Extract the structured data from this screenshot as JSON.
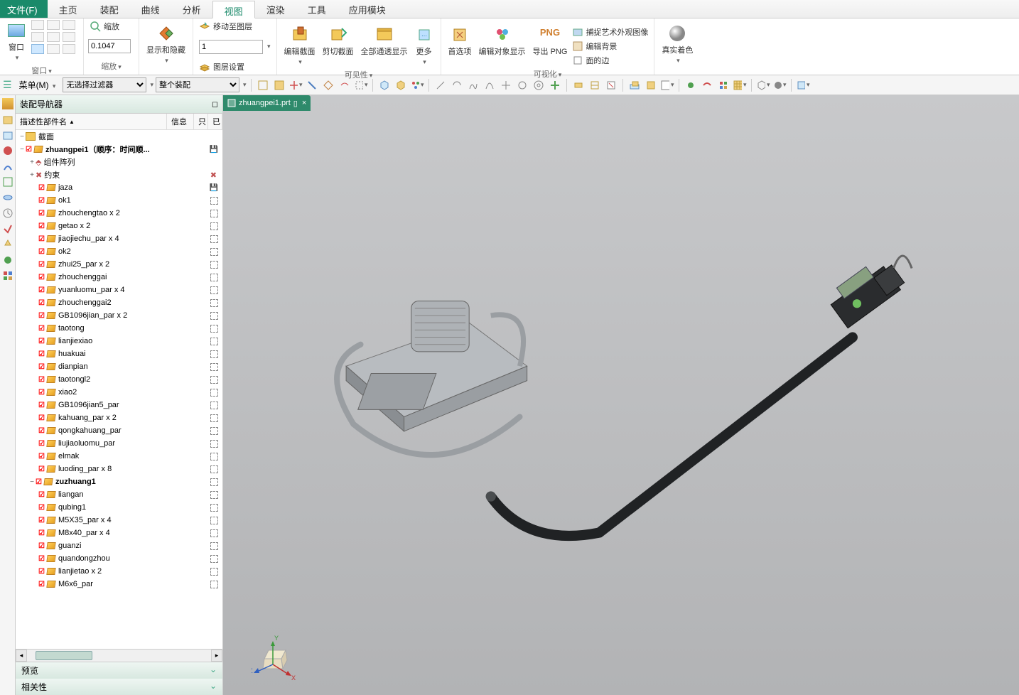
{
  "menu": {
    "file": "文件(F)",
    "tabs": [
      "主页",
      "装配",
      "曲线",
      "分析",
      "视图",
      "渲染",
      "工具",
      "应用模块"
    ],
    "active_index": 4
  },
  "ribbon": {
    "window_group": {
      "label": "窗口",
      "btn": "窗口"
    },
    "zoom_group": {
      "label": "缩放",
      "btn": "缩放",
      "value": "0.1047"
    },
    "show_hide": {
      "label": "显示和隐藏"
    },
    "layer": {
      "move": "移动至图层",
      "settings": "图层设置",
      "combo": "1"
    },
    "visibility_label": "可见性",
    "section": {
      "edit": "编辑截面",
      "cut": "剪切截面",
      "all": "全部通透显示",
      "more": "更多"
    },
    "pref": {
      "label": "首选项"
    },
    "edit_obj": {
      "label": "编辑对象显示"
    },
    "png": {
      "icon": "PNG",
      "label": "导出 PNG"
    },
    "vis_items": {
      "capture": "捕捉艺术外观图像",
      "bg": "编辑背景",
      "face": "面的边"
    },
    "visual_label": "可视化",
    "shade": {
      "label": "真实着色"
    }
  },
  "toolbar": {
    "menu_btn": "菜单(M)",
    "filter1": "无选择过滤器",
    "filter2": "整个装配"
  },
  "panel": {
    "title": "装配导航器",
    "col_name": "描述性部件名",
    "col_info": "信息",
    "col_r": "只",
    "col_c": "已",
    "section_row": "截面",
    "root": "zhuangpei1（顺序：时间顺...",
    "array": "组件阵列",
    "constraint": "约束",
    "items": [
      {
        "n": "jaza",
        "s": "disk"
      },
      {
        "n": "ok1",
        "s": "sq"
      },
      {
        "n": "zhouchengtao x 2",
        "s": "sq"
      },
      {
        "n": "getao x 2",
        "s": "sq"
      },
      {
        "n": "jiaojiechu_par x 4",
        "s": "sq"
      },
      {
        "n": "ok2",
        "s": "sq"
      },
      {
        "n": "zhui25_par x 2",
        "s": "sq"
      },
      {
        "n": "zhouchenggai",
        "s": "sq"
      },
      {
        "n": "yuanluomu_par x 4",
        "s": "sq"
      },
      {
        "n": "zhouchenggai2",
        "s": "sq"
      },
      {
        "n": "GB1096jian_par x 2",
        "s": "sq"
      },
      {
        "n": "taotong",
        "s": "sq"
      },
      {
        "n": "lianjiexiao",
        "s": "sq"
      },
      {
        "n": "huakuai",
        "s": "sq"
      },
      {
        "n": "dianpian",
        "s": "sq"
      },
      {
        "n": "taotongl2",
        "s": "sq"
      },
      {
        "n": "xiao2",
        "s": "sq"
      },
      {
        "n": "GB1096jian5_par",
        "s": "sq"
      },
      {
        "n": "kahuang_par x 2",
        "s": "sq"
      },
      {
        "n": "qongkahuang_par",
        "s": "sq"
      },
      {
        "n": "liujiaoluomu_par",
        "s": "sq"
      },
      {
        "n": "elmak",
        "s": "sq"
      },
      {
        "n": "luoding_par x 8",
        "s": "sq"
      }
    ],
    "sub_root": "zuzhuang1",
    "sub_items": [
      {
        "n": "liangan",
        "s": "sq"
      },
      {
        "n": "qubing1",
        "s": "sq"
      },
      {
        "n": "M5X35_par x 4",
        "s": "sq"
      },
      {
        "n": "M8x40_par x 4",
        "s": "sq"
      },
      {
        "n": "guanzi",
        "s": "sq"
      },
      {
        "n": "quandongzhou",
        "s": "sq"
      },
      {
        "n": "lianjietao x 2",
        "s": "sq"
      },
      {
        "n": "M6x6_par",
        "s": "sq"
      }
    ],
    "preview": "预览",
    "related": "相关性"
  },
  "doc_tab": {
    "name": "zhuangpei1.prt",
    "mod": "▯"
  },
  "triad": {
    "x": "X",
    "y": "Y",
    "z": "Z"
  }
}
